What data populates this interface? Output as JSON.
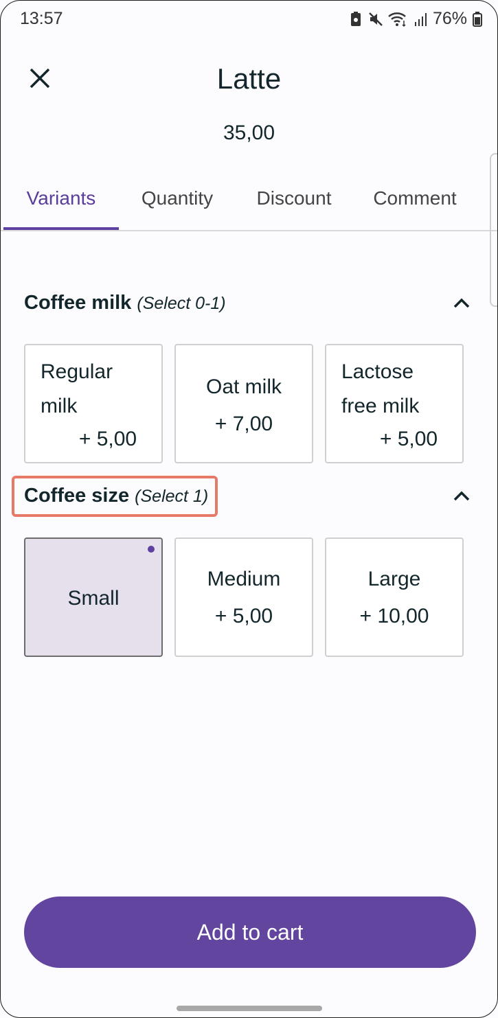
{
  "status_bar": {
    "time": "13:57",
    "battery": "76%",
    "icons": [
      "battery-saver-icon",
      "mute-icon",
      "wifi-icon",
      "signal-icon",
      "battery-icon"
    ]
  },
  "header": {
    "title": "Latte",
    "price": "35,00",
    "close_icon": "close-icon"
  },
  "tabs": [
    {
      "label": "Variants",
      "active": true
    },
    {
      "label": "Quantity",
      "active": false
    },
    {
      "label": "Discount",
      "active": false
    },
    {
      "label": "Comment",
      "active": false
    }
  ],
  "sections": [
    {
      "title": "Coffee milk",
      "hint": "(Select 0-1)",
      "options": [
        {
          "name": "Regular milk",
          "price": "+ 5,00",
          "selected": false
        },
        {
          "name": "Oat milk",
          "price": "+ 7,00",
          "selected": false
        },
        {
          "name": "Lactose free milk",
          "price": "+ 5,00",
          "selected": false
        }
      ]
    },
    {
      "title": "Coffee size",
      "hint": "(Select 1)",
      "options": [
        {
          "name": "Small",
          "price": "",
          "selected": true
        },
        {
          "name": "Medium",
          "price": "+ 5,00",
          "selected": false
        },
        {
          "name": "Large",
          "price": "+ 10,00",
          "selected": false
        }
      ]
    }
  ],
  "add_to_cart_label": "Add to cart",
  "colors": {
    "accent": "#62459f",
    "selected_bg": "#e6e0ec",
    "highlight": "#e67a66"
  }
}
